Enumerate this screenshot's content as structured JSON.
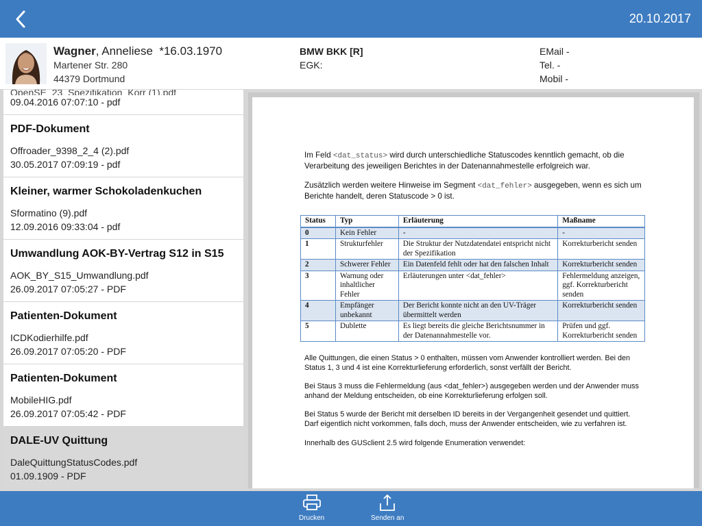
{
  "header": {
    "date": "20.10.2017"
  },
  "patient": {
    "last_name": "Wagner",
    "separator": ", ",
    "first_name": "Anneliese",
    "birth": "*16.03.1970",
    "street": "Martener Str. 280",
    "city": "44379 Dortmund",
    "insurance": "BMW BKK [R]",
    "egk": "EGK:",
    "email": "EMail -",
    "tel": "Tel. -",
    "mobil": "Mobil -"
  },
  "documents": [
    {
      "title": "",
      "file": "",
      "date": "09.04.2016 07:07:10 - pdf"
    },
    {
      "title": "PDF-Dokument",
      "file": "Offroader_9398_2_4 (2).pdf",
      "date": "30.05.2017 07:09:19 - pdf"
    },
    {
      "title": "Kleiner, warmer Schokoladenkuchen",
      "file": "Sformatino (9).pdf",
      "date": "12.09.2016 09:33:04 - pdf"
    },
    {
      "title": "Umwandlung AOK-BY-Vertrag S12 in S15",
      "file": "AOK_BY_S15_Umwandlung.pdf",
      "date": "26.09.2017 07:05:27 - PDF"
    },
    {
      "title": "Patienten-Dokument",
      "file": "ICDKodierhilfe.pdf",
      "date": "26.09.2017 07:05:20 - PDF"
    },
    {
      "title": "Patienten-Dokument",
      "file": "MobileHIG.pdf",
      "date": "26.09.2017 07:05:42 - PDF"
    },
    {
      "title": "DALE-UV Quittung",
      "file": "DaleQuittungStatusCodes.pdf",
      "date": "01.09.1909 - PDF"
    }
  ],
  "pdf": {
    "p1_a": "Im Feld ",
    "p1_code": "<dat_status>",
    "p1_b": " wird durch unterschiedliche Statuscodes kenntlich gemacht, ob die Verarbeitung des jeweiligen Berichtes in der Datenannahmestelle erfolgreich war.",
    "p2_a": "Zusätzlich werden weitere Hinweise im Segment ",
    "p2_code": "<dat_fehler>",
    "p2_b": " ausgegeben, wenn es sich um Berichte handelt, deren Statuscode > 0 ist.",
    "table_headers": [
      "Status",
      "Typ",
      "Erläuterung",
      "Maßname"
    ],
    "table_rows": [
      [
        "0",
        "Kein Fehler",
        "-",
        "-"
      ],
      [
        "1",
        "Strukturfehler",
        "Die Struktur der Nutzdatendatei entspricht nicht der Spezifikation",
        "Korrekturbericht senden"
      ],
      [
        "2",
        "Schwerer Fehler",
        "Ein Datenfeld fehlt oder hat den falschen Inhalt",
        "Korrekturbericht senden"
      ],
      [
        "3",
        "Warnung oder inhaltlicher Fehler",
        "Erläuterungen unter <dat_fehler>",
        "Fehlermeldung anzeigen, ggf. Korrekturbericht senden"
      ],
      [
        "4",
        "Empfänger unbekannt",
        "Der Bericht konnte nicht an den UV-Träger übermittelt werden",
        "Korrekturbericht senden"
      ],
      [
        "5",
        "Dublette",
        "Es liegt bereits die gleiche Berichtsnummer in der Datenannahmestelle vor.",
        "Prüfen und ggf. Korrekturbericht senden"
      ]
    ],
    "p3": "Alle Quittungen, die einen Status > 0 enthalten, müssen vom Anwender kontrolliert werden. Bei den Status 1, 3 und 4 ist eine Korrekturlieferung erforderlich, sonst verfällt der Bericht.",
    "p4": "Bei Staus 3 muss die Fehlermeldung (aus <dat_fehler>) ausgegeben werden und der Anwender muss anhand der Meldung entscheiden, ob eine Korrekturlieferung erfolgen soll.",
    "p5": "Bei Status 5 wurde der Bericht mit derselben ID bereits in der Vergangenheit gesendet und quittiert. Darf eigentlich nicht vorkommen, falls doch, muss der Anwender entscheiden, wie zu verfahren ist.",
    "p6": "Innerhalb des GUSclient 2.5 wird folgende Enumeration verwendet:"
  },
  "toolbar": {
    "print_label": "Drucken",
    "send_label": "Senden an"
  },
  "colors": {
    "accent": "#3e7cc1",
    "table_border": "#5a8ac6",
    "table_shade": "#dbe5f1"
  }
}
